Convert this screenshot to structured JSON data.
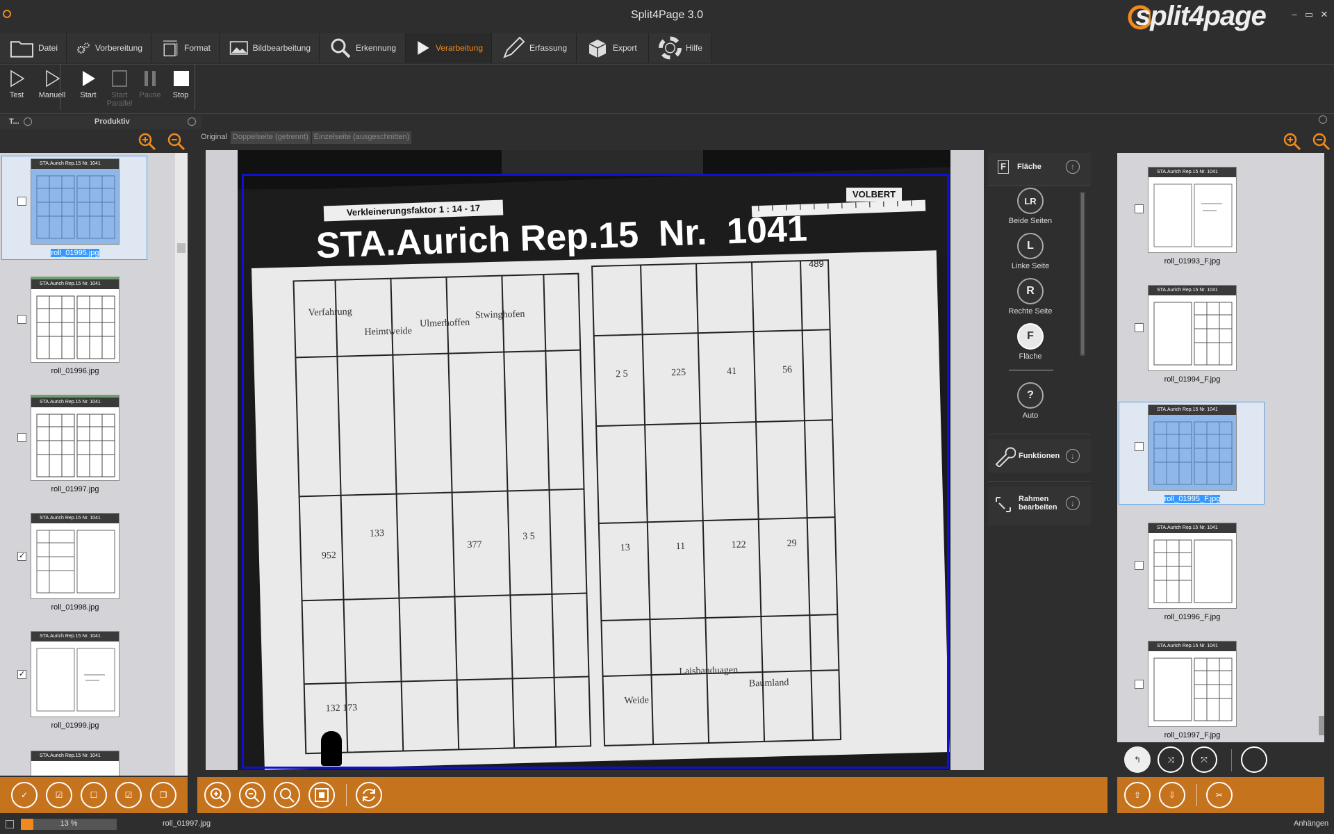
{
  "app": {
    "title": "Split4Page 3.0",
    "logo_text": "split4page"
  },
  "window_controls": [
    "–",
    "▭",
    "✕"
  ],
  "menu_tabs": [
    {
      "label": "Datei",
      "icon": "folder-icon"
    },
    {
      "label": "Vorbereitung",
      "icon": "gears-icon"
    },
    {
      "label": "Format",
      "icon": "format-icon"
    },
    {
      "label": "Bildbearbeitung",
      "icon": "image-icon"
    },
    {
      "label": "Erkennung",
      "icon": "search-icon"
    },
    {
      "label": "Verarbeitung",
      "icon": "play-icon",
      "active": true
    },
    {
      "label": "Erfassung",
      "icon": "pen-icon"
    },
    {
      "label": "Export",
      "icon": "box-icon"
    },
    {
      "label": "Hilfe",
      "icon": "lifebuoy-icon"
    }
  ],
  "toolbar": {
    "test": "Test",
    "manuell": "Manuell",
    "start": "Start",
    "start_parallel": "Start Parallel",
    "pause": "Pause",
    "stop": "Stop"
  },
  "left_header": {
    "short": "T...",
    "label": "Produktiv"
  },
  "left_thumbs": [
    {
      "name": "roll_01995.jpg",
      "checked": false,
      "selected": true
    },
    {
      "name": "roll_01996.jpg",
      "checked": false
    },
    {
      "name": "roll_01997.jpg",
      "checked": false
    },
    {
      "name": "roll_01998.jpg",
      "checked": true
    },
    {
      "name": "roll_01999.jpg",
      "checked": true
    }
  ],
  "view_tabs": [
    "Original",
    "Doppelseite (getrennt)",
    "Einzelseite (ausgeschnitten)"
  ],
  "document": {
    "factor": "Verkleinerungsfaktor 1 : 14 - 17",
    "stamp": "VOLBERT",
    "heading": "STA.Aurich Rep.15  Nr.  1041",
    "page_no": "489"
  },
  "options": {
    "section_title": "Fläche",
    "items": [
      {
        "label": "Beide Seiten",
        "glyph": "LR"
      },
      {
        "label": "Linke Seite",
        "glyph": "L"
      },
      {
        "label": "Rechte Seite",
        "glyph": "R"
      },
      {
        "label": "Fläche",
        "glyph": "F"
      },
      {
        "label": "Auto",
        "glyph": "?"
      }
    ],
    "funktionen": "Funktionen",
    "rahmen": "Rahmen bearbeiten"
  },
  "right_thumbs": [
    {
      "name": "roll_01993_F.jpg"
    },
    {
      "name": "roll_01994_F.jpg"
    },
    {
      "name": "roll_01995_F.jpg",
      "selected": true
    },
    {
      "name": "roll_01996_F.jpg"
    },
    {
      "name": "roll_01997_F.jpg"
    }
  ],
  "status": {
    "progress_text": "13 %",
    "progress": 0.13,
    "file": "roll_01997.jpg",
    "right": "Anhängen"
  },
  "colors": {
    "accent": "#f08a1c",
    "bar": "#c6731e",
    "selection": "#1010d0"
  }
}
